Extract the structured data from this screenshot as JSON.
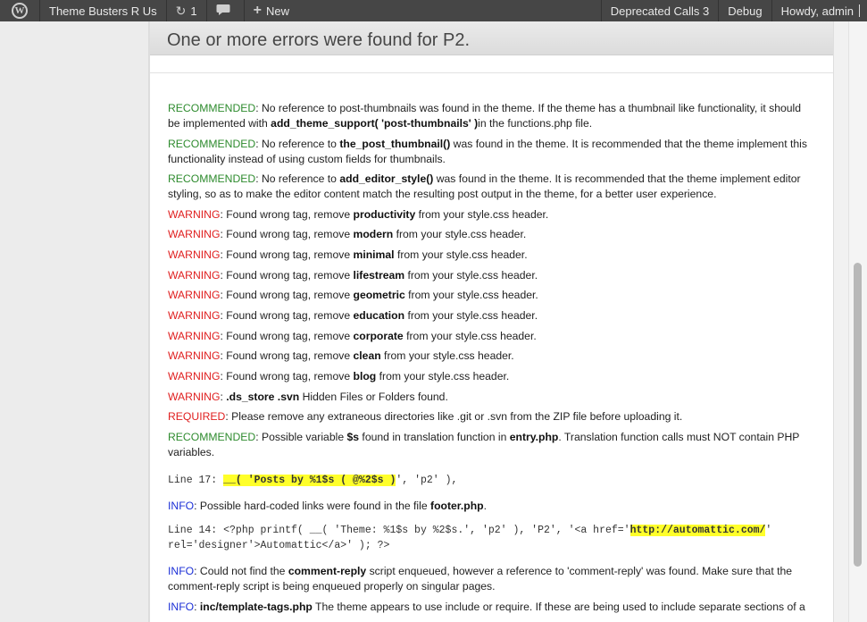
{
  "adminbar": {
    "site_name": "Theme Busters R Us",
    "updates_count": "1",
    "new_label": "New",
    "deprecated_label": "Deprecated Calls 3",
    "debug_label": "Debug",
    "howdy_label": "Howdy, admin",
    "icons": {
      "wp": "wordpress-logo-icon",
      "updates": "refresh-icon",
      "comments": "comment-bubble-icon",
      "new": "plus-icon"
    }
  },
  "panel": {
    "title": "One or more errors were found for P2."
  },
  "messages": {
    "m1": {
      "level": "RECOMMENDED",
      "t1": ": No reference to post-thumbnails was found in the theme. If the theme has a thumbnail like functionality, it should be implemented with ",
      "b1": "add_theme_support( 'post-thumbnails' )",
      "t2": "in the functions.php file."
    },
    "m2": {
      "level": "RECOMMENDED",
      "t1": ": No reference to ",
      "b1": "the_post_thumbnail()",
      "t2": " was found in the theme. It is recommended that the theme implement this functionality instead of using custom fields for thumbnails."
    },
    "m3": {
      "level": "RECOMMENDED",
      "t1": ": No reference to ",
      "b1": "add_editor_style()",
      "t2": " was found in the theme. It is recommended that the theme implement editor styling, so as to make the editor content match the resulting post output in the theme, for a better user experience."
    },
    "tags": [
      {
        "level": "WARNING",
        "tag": "productivity"
      },
      {
        "level": "WARNING",
        "tag": "modern"
      },
      {
        "level": "WARNING",
        "tag": "minimal"
      },
      {
        "level": "WARNING",
        "tag": "lifestream"
      },
      {
        "level": "WARNING",
        "tag": "geometric"
      },
      {
        "level": "WARNING",
        "tag": "education"
      },
      {
        "level": "WARNING",
        "tag": "corporate"
      },
      {
        "level": "WARNING",
        "tag": "clean"
      },
      {
        "level": "WARNING",
        "tag": "blog"
      }
    ],
    "tag_prefix": ": Found wrong tag, remove ",
    "tag_suffix": " from your style.css header.",
    "m4": {
      "level": "WARNING",
      "t1": ": ",
      "b1": ".ds_store .svn",
      "t2": " Hidden Files or Folders found."
    },
    "m5": {
      "level": "REQUIRED",
      "t1": ": Please remove any extraneous directories like .git or .svn from the ZIP file before uploading it."
    },
    "m6": {
      "level": "RECOMMENDED",
      "t1": ": Possible variable ",
      "b1": "$s",
      "t2": " found in translation function in ",
      "b2": "entry.php",
      "t3": ". Translation function calls must NOT contain PHP variables."
    },
    "code1": {
      "pre": "Line 17: ",
      "hl": "__( 'Posts by %1$s ( @%2$s )",
      "post": "', 'p2' ),"
    },
    "m7": {
      "level": "INFO",
      "t1": ": Possible hard-coded links were found in the file ",
      "b1": "footer.php",
      "t2": "."
    },
    "code2": {
      "pre": "Line 14: <?php printf( __( 'Theme: %1$s by %2$s.', 'p2' ), 'P2', '<a href='",
      "hl": "http://automattic.com/",
      "post": "'",
      "line2": "rel='designer'>Automattic</a>' ); ?>"
    },
    "m8": {
      "level": "INFO",
      "t1": ": Could not find the ",
      "b1": "comment-reply",
      "t2": " script enqueued, however a reference to 'comment-reply' was found. Make sure that the comment-reply script is being enqueued properly on singular pages."
    },
    "m9": {
      "level": "INFO",
      "t1": ": ",
      "b1": "inc/template-tags.php",
      "t2": " The theme appears to use include or require. If these are being used to include separate sections of a"
    }
  }
}
